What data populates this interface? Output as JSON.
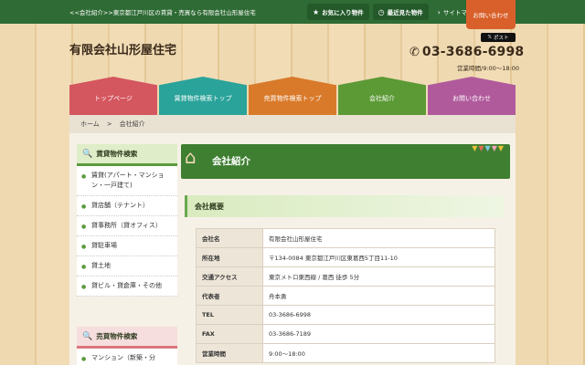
{
  "topbar": {
    "description": "<<会社紹介>>東京都江戸川区の賃貸・売買なら有限会社山形屋住宅",
    "links": [
      {
        "icon": "star-icon",
        "glyph": "★",
        "label": "お気に入り物件"
      },
      {
        "icon": "clock-icon",
        "glyph": "◷",
        "label": "最近見た物件"
      },
      {
        "icon": "chevron-icon",
        "glyph": "›",
        "label": "サイトマップ"
      }
    ],
    "contact_label": "お問い合わせ"
  },
  "header": {
    "site_title": "有限会社山形屋住宅",
    "twitter_label": "ポスト",
    "tel": "03-3686-6998",
    "hours": "営業時間/9:00～18:00"
  },
  "nav": {
    "items": [
      {
        "label": "トップページ",
        "color": "#d4565f"
      },
      {
        "label": "賃貸物件検索トップ",
        "color": "#2aa39a"
      },
      {
        "label": "売買物件検索トップ",
        "color": "#d97a2a"
      },
      {
        "label": "会社紹介",
        "color": "#5c9a36"
      },
      {
        "label": "お問い合わせ",
        "color": "#b05a9c"
      }
    ]
  },
  "breadcrumb": {
    "home": "ホーム",
    "separator": ">",
    "current": "会社紹介"
  },
  "sidebar": {
    "rent": {
      "title": "賃貸物件検索",
      "items": [
        "賃貸(アパート・マンション・一戸建て)",
        "貸店舗（テナント）",
        "貸事務所（貸オフィス）",
        "貸駐車場",
        "貸土地",
        "貸ビル・貸倉庫・その他"
      ]
    },
    "sale": {
      "title": "売買物件検索",
      "items": [
        "マンション（新築・分"
      ]
    }
  },
  "main": {
    "title": "会社紹介",
    "section_title": "会社概要",
    "table": [
      {
        "key": "会社名",
        "value": "有限会社山形屋住宅"
      },
      {
        "key": "所在地",
        "value": "〒134-0084 東京都江戸川区東葛西5丁目11-10"
      },
      {
        "key": "交通アクセス",
        "value": "東京メトロ東西線 / 葛西 徒歩 5分"
      },
      {
        "key": "代表者",
        "value": "舟本勇"
      },
      {
        "key": "TEL",
        "value": "03-3686-6998"
      },
      {
        "key": "FAX",
        "value": "03-3686-7189"
      },
      {
        "key": "営業時間",
        "value": "9:00〜18:00"
      }
    ]
  },
  "colors": {
    "topbar": "#2f6b34",
    "contact": "#d9602a",
    "accent_green": "#3f7f32"
  }
}
